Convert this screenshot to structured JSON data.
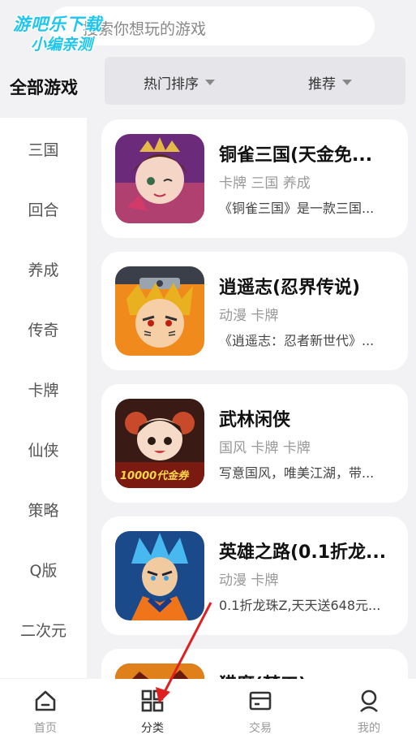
{
  "watermark": {
    "line1": "游吧乐下载",
    "line2": "小编亲测"
  },
  "search": {
    "placeholder": "搜索你想玩的游戏"
  },
  "category_header": "全部游戏",
  "filters": [
    {
      "label": "热门排序"
    },
    {
      "label": "推荐"
    }
  ],
  "sidebar": {
    "items": [
      {
        "label": "三国"
      },
      {
        "label": "回合"
      },
      {
        "label": "养成"
      },
      {
        "label": "传奇"
      },
      {
        "label": "卡牌"
      },
      {
        "label": "仙侠"
      },
      {
        "label": "策略"
      },
      {
        "label": "Q版"
      },
      {
        "label": "二次元"
      }
    ]
  },
  "games": [
    {
      "title": "铜雀三国(天金免...",
      "tags": "卡牌 三国 养成",
      "desc": "《铜雀三国》是一款三国..."
    },
    {
      "title": "逍遥志(忍界传说)",
      "tags": "动漫 卡牌",
      "desc": "《逍遥志：忍者新世代》..."
    },
    {
      "title": "武林闲侠",
      "tags": "国风 卡牌 卡牌",
      "desc": "写意国风，唯美江湖，带...",
      "badge": "10000代金券"
    },
    {
      "title": "英雄之路(0.1折龙...",
      "tags": "动漫 卡牌",
      "desc": "0.1折龙珠Z,天天送648元..."
    },
    {
      "title": "猎魔(梦工)"
    }
  ],
  "tabbar": {
    "items": [
      {
        "label": "首页",
        "icon": "home-icon"
      },
      {
        "label": "分类",
        "icon": "category-grid-icon"
      },
      {
        "label": "交易",
        "icon": "wallet-icon"
      },
      {
        "label": "我的",
        "icon": "profile-icon"
      }
    ]
  },
  "colors": {
    "accent_watermark": "#1ec6ef",
    "annotation_arrow": "#e02020",
    "background": "#f2f2f4"
  }
}
